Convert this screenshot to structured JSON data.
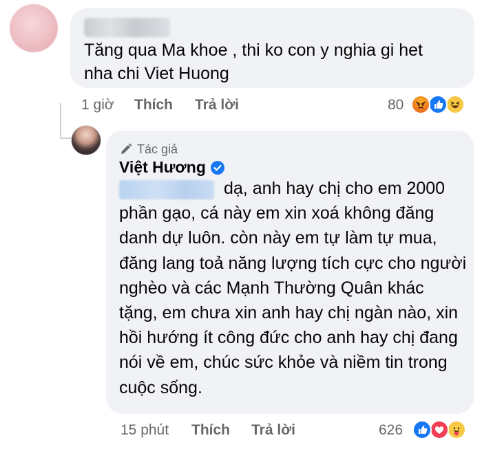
{
  "top_comment": {
    "text": "Tăng qua Ma khoe , thi ko con y nghia gi het nha chi Viet Huong",
    "time": "1 giờ",
    "like_label": "Thích",
    "reply_label": "Trả lời",
    "reaction_count": "80",
    "reactions": [
      "angry-icon",
      "like-icon",
      "haha-icon"
    ]
  },
  "reply": {
    "author_badge": "Tác giả",
    "author_name": "Việt Hương",
    "text": "dạ, anh hay chị cho em 2000 phần gạo, cá này em xin xoá không đăng danh dự luôn. còn này em tự làm tự mua, đăng lang toả năng lượng tích cực cho người nghèo và các Mạnh Thường Quân khác tặng, em chưa xin anh hay chị ngàn nào, xin hồi hướng ít công đức cho anh hay chị đang nói về em, chúc sức khỏe và niềm tin trong cuộc sống.",
    "time": "15 phút",
    "like_label": "Thích",
    "reply_label": "Trả lời",
    "reaction_count": "626",
    "reactions": [
      "like-icon",
      "love-icon",
      "care-icon"
    ]
  },
  "colors": {
    "bubble": "#f0f2f5",
    "meta_text": "#65676b",
    "like_blue": "#1877f2",
    "love_red": "#f33e58"
  }
}
